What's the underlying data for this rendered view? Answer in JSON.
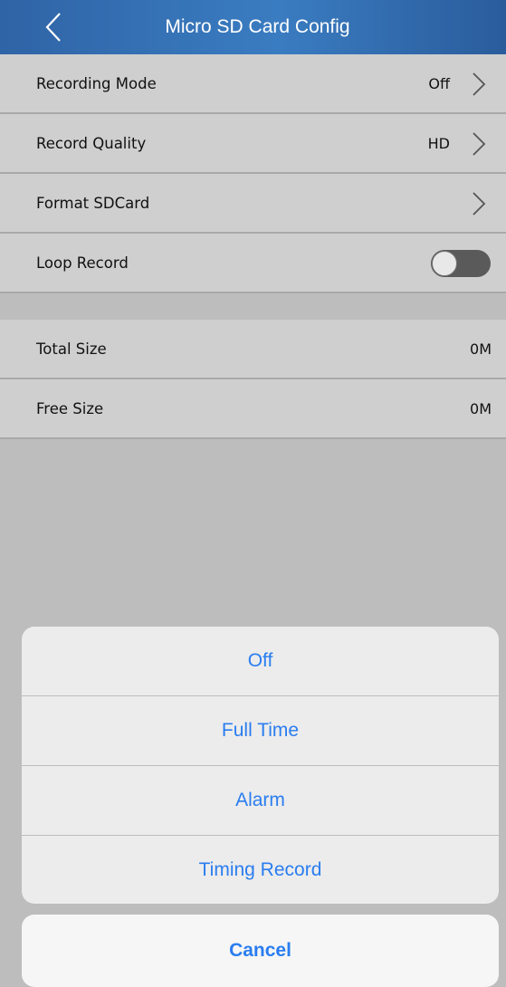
{
  "header": {
    "title": "Micro SD Card Config",
    "back_icon": "chevron-left-icon"
  },
  "settings": {
    "recording_mode": {
      "label": "Recording Mode",
      "value": "Off"
    },
    "record_quality": {
      "label": "Record Quality",
      "value": "HD"
    },
    "format_sdcard": {
      "label": "Format SDCard"
    },
    "loop_record": {
      "label": "Loop Record",
      "enabled": false
    }
  },
  "storage": {
    "total_size": {
      "label": "Total Size",
      "value": "0M"
    },
    "free_size": {
      "label": "Free Size",
      "value": "0M"
    }
  },
  "action_sheet": {
    "options": [
      "Off",
      "Full Time",
      "Alarm",
      "Timing Record"
    ],
    "cancel_label": "Cancel"
  },
  "colors": {
    "nav_bar": "#3a7cc1",
    "accent": "#2a7df0"
  }
}
